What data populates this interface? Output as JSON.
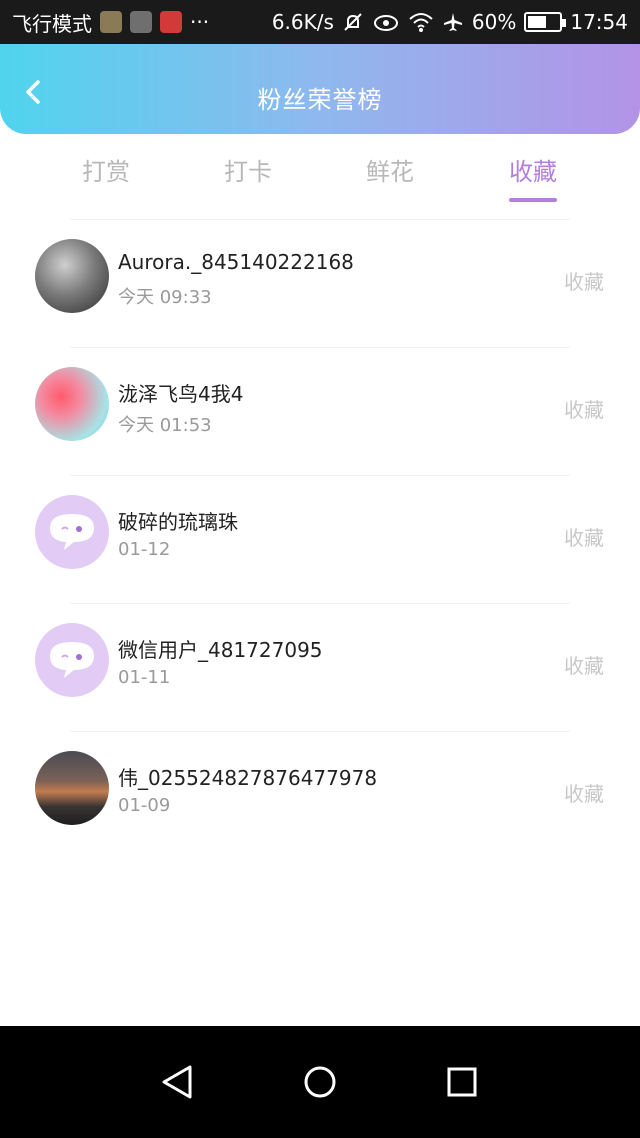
{
  "status_bar": {
    "carrier_text": "飞行模式",
    "more": "···",
    "speed": "6.6K/s",
    "battery_percent": "60%",
    "battery_level": 0.6,
    "time": "17:54",
    "icons": [
      "notification-muted-icon",
      "eye-icon",
      "wifi-icon",
      "airplane-icon",
      "battery-icon"
    ]
  },
  "header": {
    "title": "粉丝荣誉榜"
  },
  "tabs": [
    {
      "label": "打赏",
      "active": false
    },
    {
      "label": "打卡",
      "active": false
    },
    {
      "label": "鲜花",
      "active": false
    },
    {
      "label": "收藏",
      "active": true
    }
  ],
  "fans": [
    {
      "name": "Aurora._845140222168",
      "time": "今天 09:33",
      "action": "收藏",
      "avatar": "photo"
    },
    {
      "name": "泷泽飞鸟4我4",
      "time": "今天 01:53",
      "action": "收藏",
      "avatar": "photo"
    },
    {
      "name": "破碎的琉璃珠",
      "time": "01-12",
      "action": "收藏",
      "avatar": "default"
    },
    {
      "name": "微信用户_481727095",
      "time": "01-11",
      "action": "收藏",
      "avatar": "default"
    },
    {
      "name": "伟_025524827876477978",
      "time": "01-09",
      "action": "收藏",
      "avatar": "photo"
    }
  ],
  "colors": {
    "accent": "#b27fdc",
    "header_gradient_start": "#4fd4ee",
    "header_gradient_end": "#b393e6",
    "default_avatar_bg": "#e2ccf5"
  }
}
